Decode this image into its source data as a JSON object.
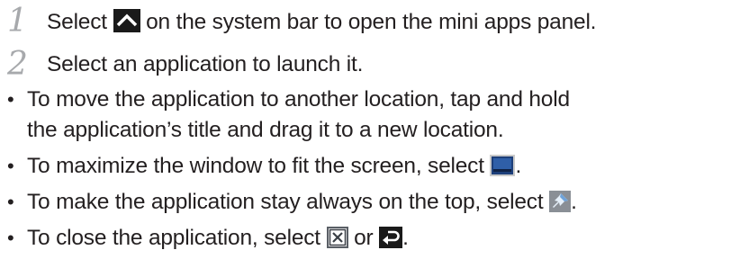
{
  "steps": [
    {
      "number": "1",
      "text_before": "Select",
      "icon": "system-bar-up-arrow-icon",
      "text_after": "on the system bar to open the mini apps panel."
    },
    {
      "number": "2",
      "text": "Select an application to launch it."
    }
  ],
  "bullets": [
    {
      "line1": "To move the application to another location, tap and hold",
      "line2": "the application’s title and drag it to a new location."
    },
    {
      "text": "To maximize the window to fit the screen, select",
      "icon": "maximize-window-icon",
      "end": "."
    },
    {
      "text": "To make the application stay always on the top, select",
      "icon": "pin-icon",
      "end": "."
    },
    {
      "text": "To close the application, select",
      "icon_a": "close-box-icon",
      "middle": "or",
      "icon_b": "back-arrow-icon",
      "end": "."
    }
  ],
  "colors": {
    "text": "#231f20",
    "step_number": "#a7a9ac",
    "icon_dark": "#2b2b2b",
    "icon_blue": "#1d3f7a"
  }
}
